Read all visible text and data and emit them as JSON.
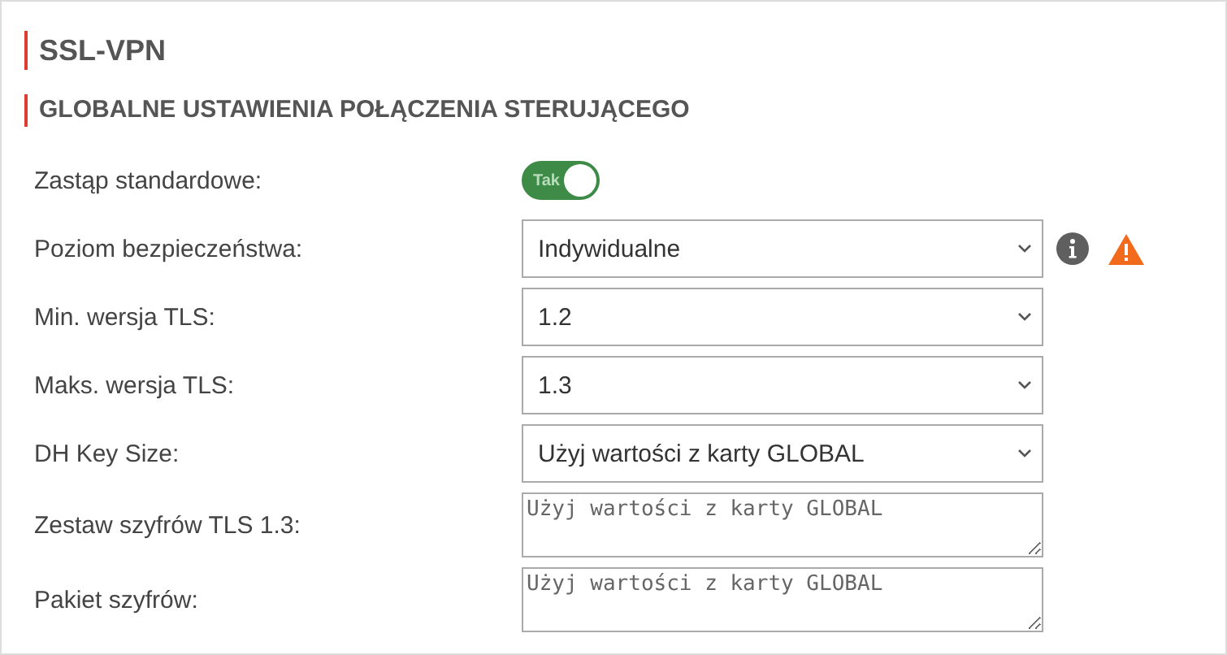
{
  "title": "SSL-VPN",
  "section": {
    "heading": "GLOBALNE USTAWIENIA POŁĄCZENIA STERUJĄCEGO"
  },
  "rows": [
    {
      "kind": "toggle",
      "label": "Zastąp standardowe:",
      "on": true,
      "text": "Tak"
    },
    {
      "kind": "select",
      "label": "Poziom bezpieczeństwa:",
      "value": "Indywidualne",
      "info": true,
      "warning": true
    },
    {
      "kind": "select",
      "label": "Min. wersja TLS:",
      "value": "1.2"
    },
    {
      "kind": "select",
      "label": "Maks. wersja TLS:",
      "value": "1.3"
    },
    {
      "kind": "select",
      "label": "DH Key Size:",
      "value": "Użyj wartości z karty GLOBAL"
    },
    {
      "kind": "textarea",
      "label": "Zestaw szyfrów TLS 1.3:",
      "placeholder": "Użyj wartości z karty GLOBAL"
    },
    {
      "kind": "textarea",
      "label": "Pakiet szyfrów:",
      "placeholder": "Użyj wartości z karty GLOBAL"
    }
  ]
}
